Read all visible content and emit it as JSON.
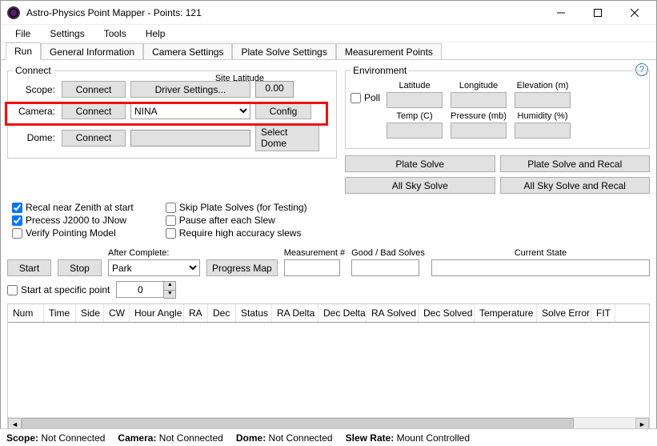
{
  "window": {
    "title": "Astro-Physics Point Mapper - Points: 121"
  },
  "menu": [
    "File",
    "Settings",
    "Tools",
    "Help"
  ],
  "tabs": [
    "Run",
    "General Information",
    "Camera Settings",
    "Plate Solve Settings",
    "Measurement Points"
  ],
  "active_tab": 0,
  "connect": {
    "legend": "Connect",
    "rows": {
      "scope": {
        "label": "Scope:",
        "btn": "Connect",
        "settings_btn": "Driver Settings...",
        "site_label": "Site Latitude",
        "site_value": "0.00"
      },
      "camera": {
        "label": "Camera:",
        "btn": "Connect",
        "combo_value": "NINA",
        "config_btn": "Config"
      },
      "dome": {
        "label": "Dome:",
        "btn": "Connect",
        "select_btn": "Select Dome"
      }
    }
  },
  "environment": {
    "legend": "Environment",
    "poll_label": "Poll",
    "fields_top": [
      "Latitude",
      "Longitude",
      "Elevation (m)"
    ],
    "fields_bot": [
      "Temp (C)",
      "Pressure (mb)",
      "Humidity (%)"
    ]
  },
  "solve_buttons": {
    "plate_solve": "Plate Solve",
    "plate_solve_recal": "Plate Solve and Recal",
    "all_sky": "All Sky Solve",
    "all_sky_recal": "All Sky Solve and Recal"
  },
  "checkboxes_left": [
    {
      "label": "Recal near Zenith at start",
      "checked": true
    },
    {
      "label": "Precess J2000 to JNow",
      "checked": true
    },
    {
      "label": "Verify Pointing Model",
      "checked": false
    }
  ],
  "checkboxes_right": [
    {
      "label": "Skip Plate Solves (for Testing)",
      "checked": false
    },
    {
      "label": "Pause after each Slew",
      "checked": false
    },
    {
      "label": "Require high accuracy slews",
      "checked": false
    }
  ],
  "controls": {
    "start": "Start",
    "stop": "Stop",
    "after_complete_label": "After Complete:",
    "after_complete_value": "Park",
    "progress_map": "Progress Map",
    "measurement_label": "Measurement #",
    "measurement_value": "",
    "goodbad_label": "Good / Bad Solves",
    "goodbad_value": "",
    "current_state_label": "Current State",
    "current_state_value": "",
    "start_at_point_label": "Start at specific point",
    "start_at_point_value": "0"
  },
  "table_columns": [
    "Num",
    "Time",
    "Side",
    "CW",
    "Hour Angle",
    "RA",
    "Dec",
    "Status",
    "RA Delta",
    "Dec Delta",
    "RA Solved",
    "Dec Solved",
    "Temperature",
    "Solve Error",
    "FIT"
  ],
  "status": {
    "scope_label": "Scope:",
    "scope_val": "Not Connected",
    "camera_label": "Camera:",
    "camera_val": "Not Connected",
    "dome_label": "Dome:",
    "dome_val": "Not Connected",
    "slew_label": "Slew Rate:",
    "slew_val": "Mount Controlled"
  },
  "help_icon": "?"
}
